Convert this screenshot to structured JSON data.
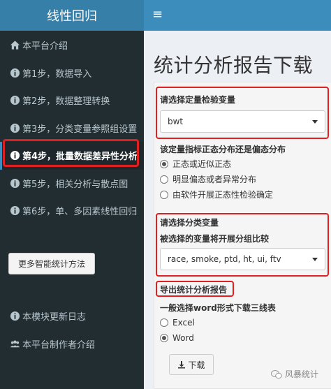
{
  "sidebar": {
    "logo": "线性回归",
    "items": [
      {
        "icon": "home-icon",
        "label": "本平台介绍"
      },
      {
        "icon": "info-icon",
        "label": "第1步，数据导入"
      },
      {
        "icon": "info-icon",
        "label": "第2步，数据整理转换"
      },
      {
        "icon": "info-icon",
        "label": "第3步，分类变量参照组设置"
      },
      {
        "icon": "info-icon",
        "label": "第4步，批量数据差异性分析"
      },
      {
        "icon": "info-icon",
        "label": "第5步，相关分析与散点图"
      },
      {
        "icon": "info-icon",
        "label": "第6步，单、多因素线性回归"
      }
    ],
    "active_index": 4,
    "more_button": "更多智能统计方法",
    "bottom_items": [
      {
        "icon": "info-icon",
        "label": "本模块更新日志"
      },
      {
        "icon": "users-icon",
        "label": "本平台制作者介绍"
      }
    ]
  },
  "header": {
    "toggle_icon": "hamburger-icon",
    "toggle_glyph": "≡"
  },
  "main": {
    "title": "统计分析报告下载",
    "outcome": {
      "label": "请选择定量检验变量",
      "value": "bwt"
    },
    "distribution": {
      "label": "该定量指标正态分布还是偏态分布",
      "options": [
        "正态或近似正态",
        "明显偏态或者异常分布",
        "由软件开展正态性检验确定"
      ],
      "selected": 0
    },
    "group": {
      "label": "请选择分类变量",
      "sublabel": "被选择的变量将开展分组比较",
      "value": "race, smoke, ptd, ht, ui, ftv"
    },
    "export": {
      "label": "导出统计分析报告",
      "sublabel": "一般选择word形式下载三线表",
      "options": [
        "Excel",
        "Word"
      ],
      "selected": 1,
      "download_label": "下载"
    }
  },
  "watermark": "风暴统计",
  "colors": {
    "header": "#3c8dbc",
    "logo": "#367fa9",
    "sidebar": "#222d32",
    "highlight": "#e02020"
  }
}
